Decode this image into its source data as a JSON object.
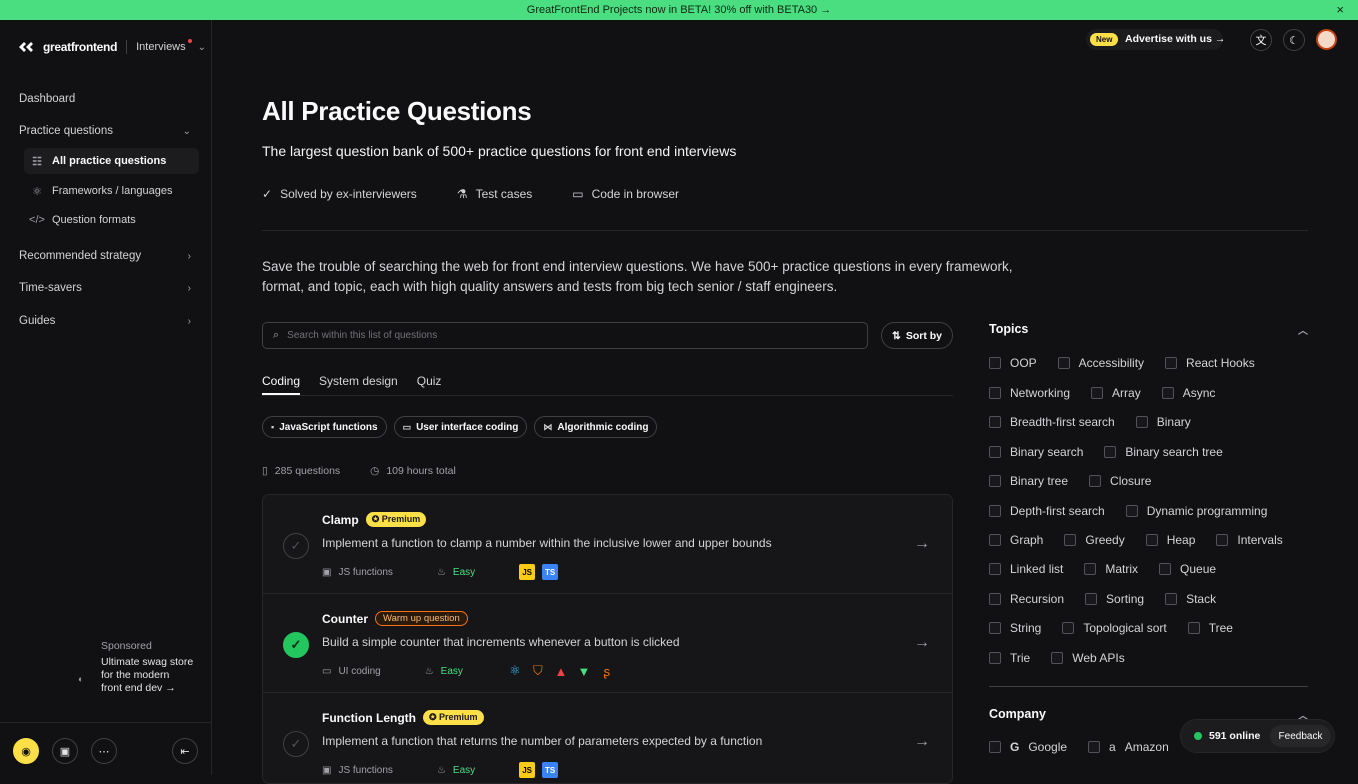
{
  "banner": {
    "text": "GreatFrontEnd Projects now in BETA! 30% off with BETA30 →",
    "close": "×"
  },
  "logo": {
    "name": "greatfrontend",
    "product": "Interviews"
  },
  "sidebar": {
    "dashboard": "Dashboard",
    "practice": "Practice questions",
    "sub_items": [
      {
        "label": "All practice questions",
        "icon": "list-icon"
      },
      {
        "label": "Frameworks / languages",
        "icon": "atom-icon"
      },
      {
        "label": "Question formats",
        "icon": "code-icon"
      }
    ],
    "recommended": "Recommended strategy",
    "timesavers": "Time-savers",
    "guides": "Guides",
    "sponsored_label": "Sponsored",
    "sponsored_text": [
      "Ultimate swag store",
      "for the modern",
      "front end dev →"
    ]
  },
  "header": {
    "new_badge": "New",
    "advertise": "Advertise with us →"
  },
  "main": {
    "title": "All Practice Questions",
    "subtitle": "The largest question bank of 500+ practice questions for front end interviews",
    "features": [
      "Solved by ex-interviewers",
      "Test cases",
      "Code in browser"
    ],
    "description_1": "Save the trouble of searching the web for front end interview questions. We have 500+ practice questions in every framework,",
    "description_2": "format, and topic, each with high quality answers and tests from big tech senior / staff engineers.",
    "search_placeholder": "Search within this list of questions",
    "sort_label": "Sort by",
    "tabs": [
      "Coding",
      "System design",
      "Quiz"
    ],
    "chips": [
      "JavaScript functions",
      "User interface coding",
      "Algorithmic coding"
    ],
    "stat_questions": "285 questions",
    "stat_hours": "109 hours total"
  },
  "questions": [
    {
      "title": "Clamp",
      "badge": "Premium",
      "badge_type": "premium",
      "desc": "Implement a function to clamp a number within the inclusive lower and upper bounds",
      "format": "JS functions",
      "difficulty": "Easy",
      "done": false,
      "langs": [
        "JS",
        "TS"
      ]
    },
    {
      "title": "Counter",
      "badge": "Warm up question",
      "badge_type": "warm",
      "desc": "Build a simple counter that increments whenever a button is clicked",
      "format": "UI coding",
      "difficulty": "Easy",
      "done": true,
      "langs": []
    },
    {
      "title": "Function Length",
      "badge": "Premium",
      "badge_type": "premium",
      "desc": "Implement a function that returns the number of parameters expected by a function",
      "format": "JS functions",
      "difficulty": "Easy",
      "done": false,
      "langs": [
        "JS",
        "TS"
      ]
    }
  ],
  "topics_title": "Topics",
  "topics_rows": [
    [
      "OOP",
      "Accessibility",
      "React Hooks"
    ],
    [
      "Networking",
      "Array",
      "Async"
    ],
    [
      "Breadth-first search",
      "Binary"
    ],
    [
      "Binary search",
      "Binary search tree"
    ],
    [
      "Binary tree",
      "Closure"
    ],
    [
      "Depth-first search",
      "Dynamic programming"
    ],
    [
      "Graph",
      "Greedy",
      "Heap",
      "Intervals"
    ],
    [
      "Linked list",
      "Matrix",
      "Queue"
    ],
    [
      "Recursion",
      "Sorting",
      "Stack"
    ],
    [
      "String",
      "Topological sort",
      "Tree"
    ],
    [
      "Trie",
      "Web APIs"
    ]
  ],
  "company_title": "Company",
  "companies": [
    "Google",
    "Amazon"
  ],
  "online": {
    "count": "591 online",
    "feedback": "Feedback"
  },
  "colors": {
    "accent_green": "#22c55e",
    "premium_yellow": "#fde047",
    "warm_orange": "#f97316"
  }
}
